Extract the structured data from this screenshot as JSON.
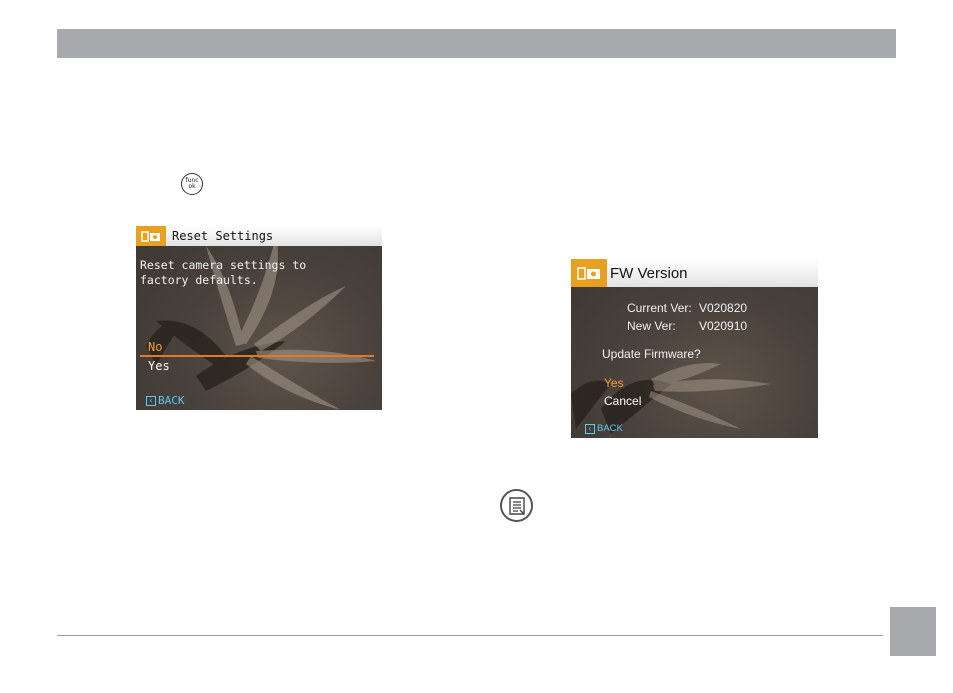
{
  "func_ok_icon": {
    "line1": "func",
    "line2": "ok"
  },
  "reset_screen": {
    "title": "Reset Settings",
    "message_line1": "Reset camera settings to",
    "message_line2": "factory defaults.",
    "option_no": "No",
    "option_yes": "Yes",
    "back": "BACK"
  },
  "fw_screen": {
    "title": "FW Version",
    "current_label": "Current Ver:",
    "current_value": "V020820",
    "new_label": "New Ver:",
    "new_value": "V020910",
    "prompt": "Update Firmware?",
    "option_yes": "Yes",
    "option_cancel": "Cancel",
    "back": "BACK"
  },
  "colors": {
    "header_bar": "#a7a9ac",
    "tab_orange": "#e8a020",
    "highlight_orange": "#f39a2e",
    "back_cyan": "#5ec8f0"
  },
  "icons": [
    "func-ok-button-icon",
    "settings-tab-icon",
    "back-icon",
    "note-icon"
  ]
}
